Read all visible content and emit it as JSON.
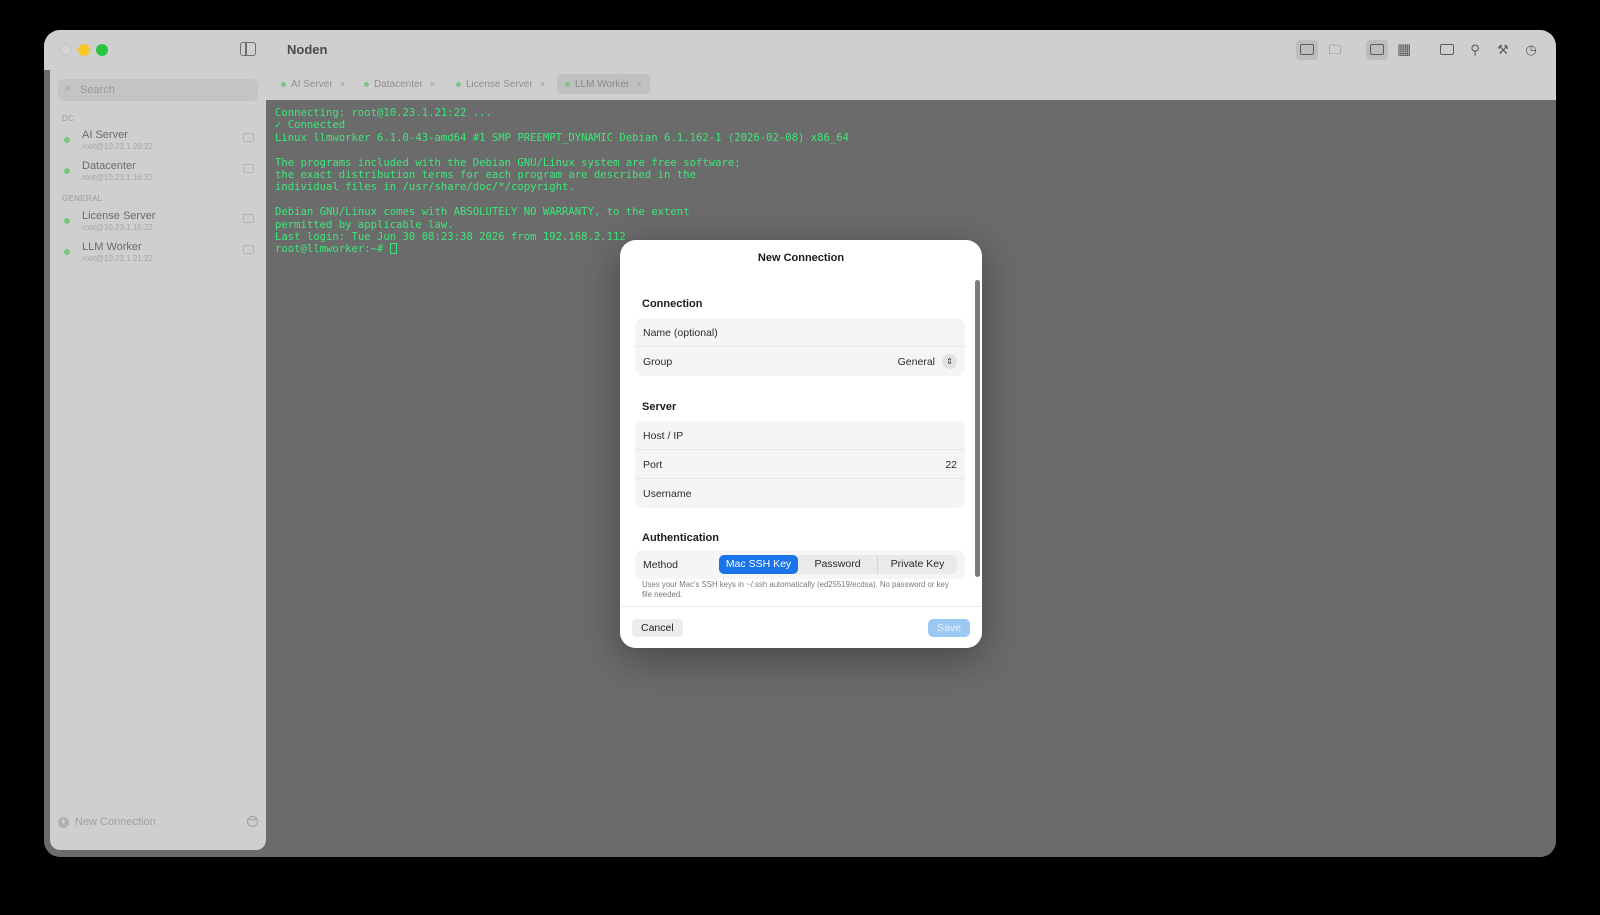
{
  "window": {
    "app_title": "Noden"
  },
  "sidebar": {
    "search_placeholder": "Search",
    "groups": [
      {
        "label": "DC",
        "items": [
          {
            "name": "AI Server",
            "sub": "root@10.23.1.20:22"
          },
          {
            "name": "Datacenter",
            "sub": "root@10.23.1.16:22"
          }
        ]
      },
      {
        "label": "GENERAL",
        "items": [
          {
            "name": "License Server",
            "sub": "root@10.23.1.15:22"
          },
          {
            "name": "LLM Worker",
            "sub": "root@10.23.1.21:22"
          }
        ]
      }
    ],
    "new_connection_label": "New Connection"
  },
  "tabs": [
    {
      "label": "AI Server",
      "close": "×"
    },
    {
      "label": "Datacenter",
      "close": "×"
    },
    {
      "label": "License Server",
      "close": "×"
    },
    {
      "label": "LLM Worker",
      "close": "×"
    }
  ],
  "terminal": {
    "lines": [
      "Connecting: root@10.23.1.21:22 ...",
      "✓ Connected",
      "Linux llmworker 6.1.0-43-amd64 #1 SMP PREEMPT_DYNAMIC Debian 6.1.162-1 (2026-02-08) x86_64",
      "",
      "The programs included with the Debian GNU/Linux system are free software;",
      "the exact distribution terms for each program are described in the",
      "individual files in /usr/share/doc/*/copyright.",
      "",
      "Debian GNU/Linux comes with ABSOLUTELY NO WARRANTY, to the extent",
      "permitted by applicable law.",
      "Last login: Tue Jun 30 08:23:38 2026 from 192.168.2.112",
      "root@llmworker:~# "
    ]
  },
  "modal": {
    "title": "New Connection",
    "connection": {
      "heading": "Connection",
      "name_label": "Name (optional)",
      "group_label": "Group",
      "group_value": "General"
    },
    "server": {
      "heading": "Server",
      "host_label": "Host / IP",
      "port_label": "Port",
      "port_value": "22",
      "username_label": "Username"
    },
    "authentication": {
      "heading": "Authentication",
      "method_label": "Method",
      "methods": [
        "Mac SSH Key",
        "Password",
        "Private Key"
      ],
      "selected": "Mac SSH Key",
      "hint": "Uses your Mac's SSH keys in ~/.ssh automatically (ed25519/ecdsa). No password or key file needed."
    },
    "cancel_label": "Cancel",
    "save_label": "Save"
  },
  "colors": {
    "terminal_text": "#3ee67a",
    "accent": "#1a73e8",
    "status_online": "#79c77f"
  }
}
